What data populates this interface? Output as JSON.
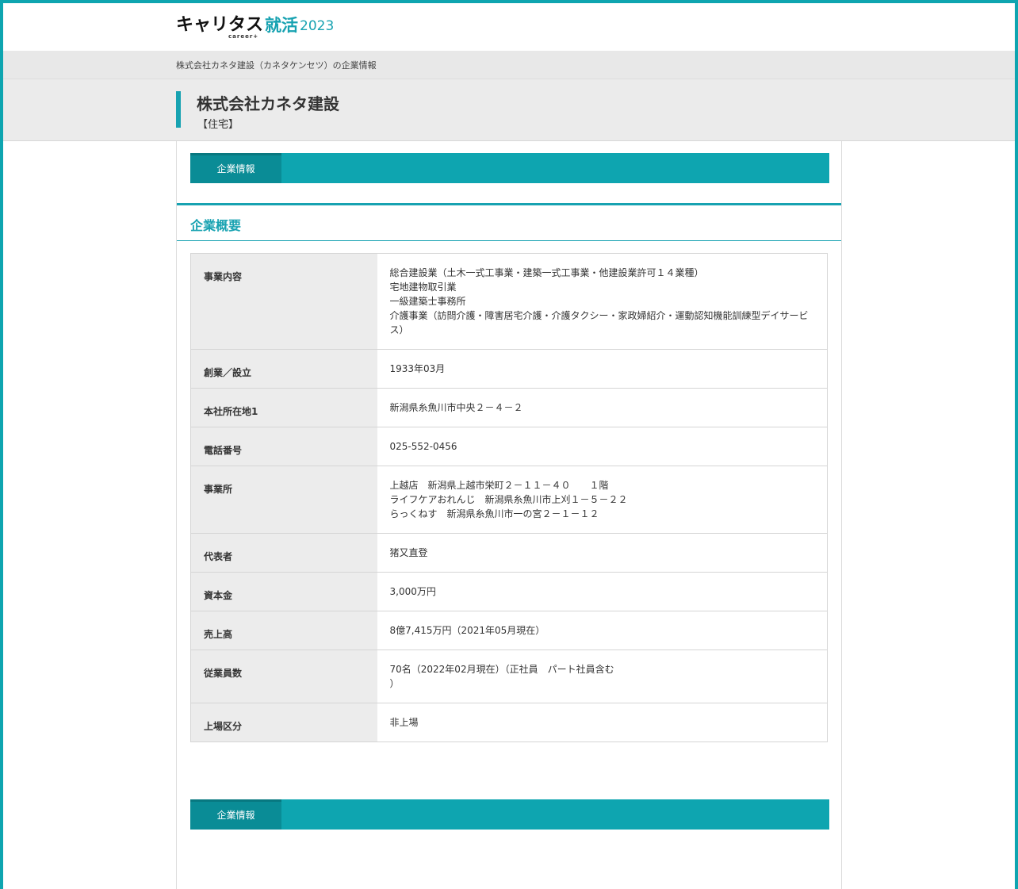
{
  "header": {
    "logo_main": "キャリタス",
    "logo_accent": "就活",
    "logo_year": "2023",
    "logo_sub": "career+"
  },
  "breadcrumb": "株式会社カネタ建設（カネタケンセツ）の企業情報",
  "company": {
    "name": "株式会社カネタ建設",
    "industry": "【住宅】"
  },
  "tabs": {
    "top_label": "企業情報",
    "bottom_label": "企業情報"
  },
  "section_title": "企業概要",
  "rows": [
    {
      "label": "事業内容",
      "lines": [
        "総合建設業（土木一式工事業・建築一式工事業・他建設業許可１４業種）",
        "宅地建物取引業",
        "一級建築士事務所",
        "介護事業（訪問介護・障害居宅介護・介護タクシー・家政婦紹介・運動認知機能訓練型デイサービ",
        "ス）"
      ]
    },
    {
      "label": "創業／設立",
      "lines": [
        "1933年03月"
      ]
    },
    {
      "label": "本社所在地1",
      "lines": [
        "新潟県糸魚川市中央２－４－２"
      ]
    },
    {
      "label": "電話番号",
      "lines": [
        "025-552-0456"
      ]
    },
    {
      "label": "事業所",
      "lines": [
        "上越店　新潟県上越市栄町２－１１－４０　　１階",
        "ライフケアおれんじ　新潟県糸魚川市上刈１－５－２２",
        "らっくねす　新潟県糸魚川市一の宮２－１－１２"
      ]
    },
    {
      "label": "代表者",
      "lines": [
        "猪又直登"
      ]
    },
    {
      "label": "資本金",
      "lines": [
        "3,000万円"
      ]
    },
    {
      "label": "売上高",
      "lines": [
        "8億7,415万円（2021年05月現在）"
      ]
    },
    {
      "label": "従業員数",
      "lines": [
        "70名（2022年02月現在）（正社員　パート社員含む",
        "）"
      ]
    },
    {
      "label": "上場区分",
      "lines": [
        "非上場"
      ]
    }
  ],
  "colors": {
    "accent": "#17a2b1",
    "tab_bg": "#0ea5b0",
    "tab_active": "#0a8c96"
  }
}
